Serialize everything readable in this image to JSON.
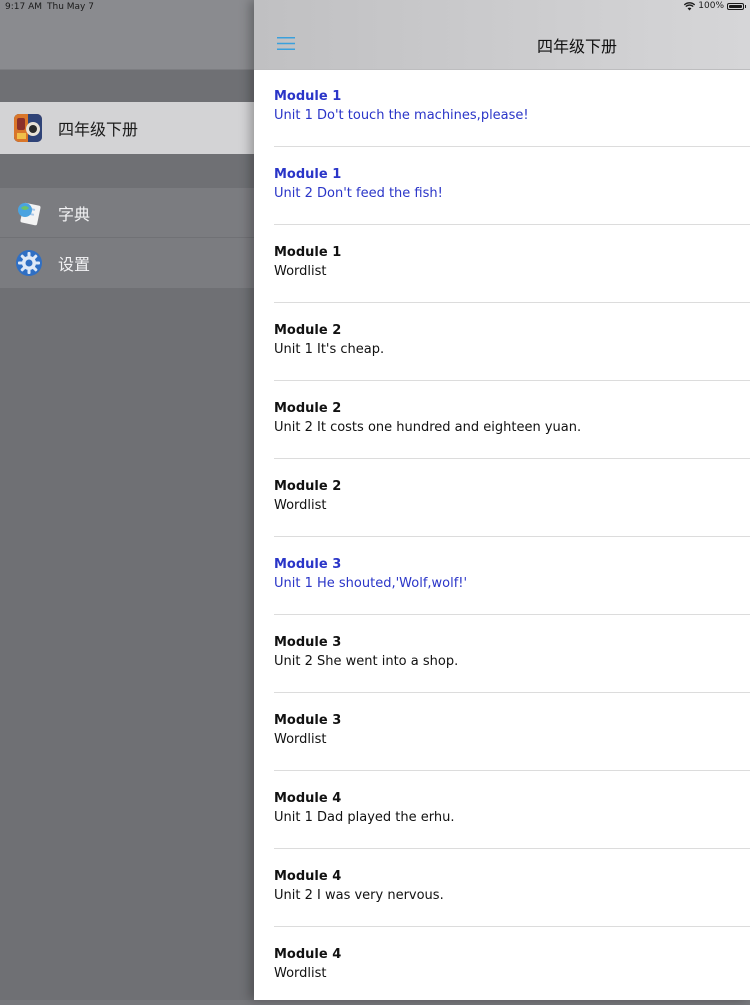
{
  "status_bar": {
    "time": "9:17 AM",
    "date": "Thu May 7",
    "battery": "100%"
  },
  "sidebar": {
    "book": {
      "label": "四年级下册",
      "icon": "book-cover-icon"
    },
    "items": [
      {
        "label": "字典",
        "icon": "dictionary-icon"
      },
      {
        "label": "设置",
        "icon": "gear-icon"
      }
    ]
  },
  "nav": {
    "title": "四年级下册",
    "menu_icon": "hamburger-menu-icon"
  },
  "colors": {
    "highlight": "#2a35c8",
    "text": "#111111",
    "menu_icon": "#3aa0dc"
  },
  "list": [
    {
      "title": "Module 1",
      "subtitle": "Unit 1 Do't touch the machines,please!",
      "highlighted": true
    },
    {
      "title": "Module 1",
      "subtitle": "Unit 2 Don't feed the fish!",
      "highlighted": true
    },
    {
      "title": "Module 1",
      "subtitle": "Wordlist",
      "highlighted": false
    },
    {
      "title": "Module 2",
      "subtitle": "Unit 1 It's cheap.",
      "highlighted": false
    },
    {
      "title": "Module 2",
      "subtitle": "Unit 2 It costs one hundred and eighteen yuan.",
      "highlighted": false
    },
    {
      "title": "Module 2",
      "subtitle": "Wordlist",
      "highlighted": false
    },
    {
      "title": "Module 3",
      "subtitle": "Unit 1 He shouted,'Wolf,wolf!'",
      "highlighted": true
    },
    {
      "title": "Module 3",
      "subtitle": "Unit 2 She went into a shop.",
      "highlighted": false
    },
    {
      "title": "Module 3",
      "subtitle": "Wordlist",
      "highlighted": false
    },
    {
      "title": "Module 4",
      "subtitle": "Unit 1 Dad played the erhu.",
      "highlighted": false
    },
    {
      "title": "Module 4",
      "subtitle": "Unit 2 I was very nervous.",
      "highlighted": false
    },
    {
      "title": "Module 4",
      "subtitle": "Wordlist",
      "highlighted": false
    }
  ]
}
